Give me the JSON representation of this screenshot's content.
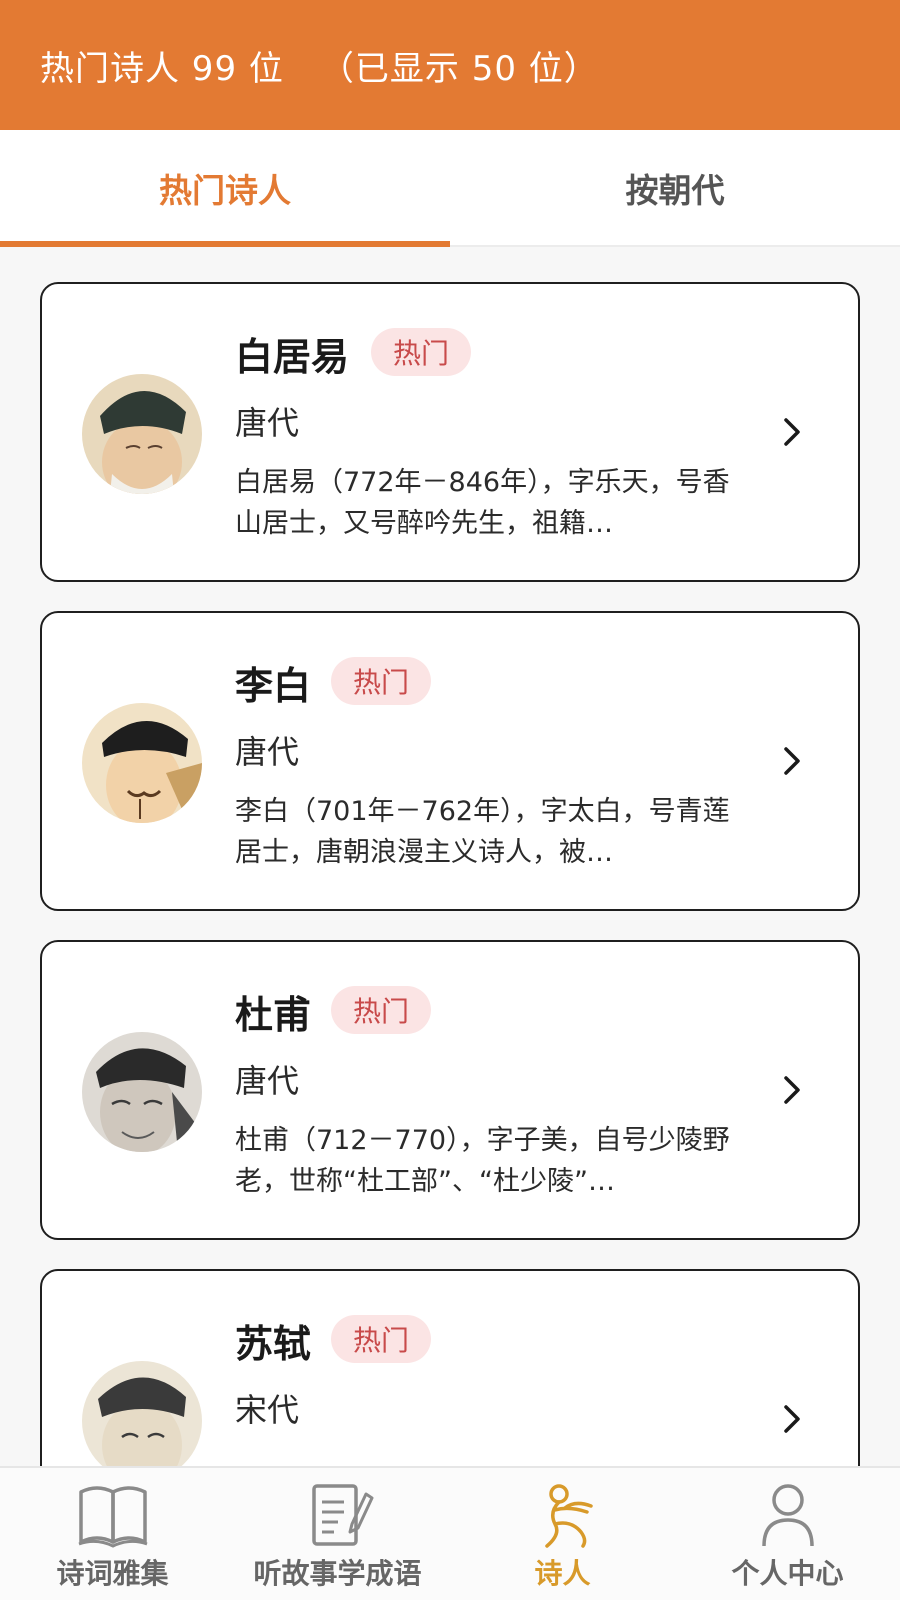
{
  "header": {
    "title": "热门诗人 99 位",
    "shown": "（已显示 50 位）"
  },
  "tabs": [
    {
      "label": "热门诗人",
      "active": true
    },
    {
      "label": "按朝代",
      "active": false
    }
  ],
  "poets": [
    {
      "name": "白居易",
      "badge": "热门",
      "dynasty": "唐代",
      "desc": "白居易（772年－846年），字乐天，号香山居士，又号醉吟先生，祖籍…"
    },
    {
      "name": "李白",
      "badge": "热门",
      "dynasty": "唐代",
      "desc": "李白（701年－762年），字太白，号青莲居士，唐朝浪漫主义诗人，被…"
    },
    {
      "name": "杜甫",
      "badge": "热门",
      "dynasty": "唐代",
      "desc": "杜甫（712－770），字子美，自号少陵野老，世称“杜工部”、“杜少陵”…"
    },
    {
      "name": "苏轼",
      "badge": "热门",
      "dynasty": "宋代",
      "desc": ""
    }
  ],
  "bottom_nav": [
    {
      "label": "诗词雅集",
      "icon": "book-icon",
      "active": false
    },
    {
      "label": "听故事学成语",
      "icon": "notepad-icon",
      "active": false
    },
    {
      "label": "诗人",
      "icon": "poet-icon",
      "active": true
    },
    {
      "label": "个人中心",
      "icon": "person-icon",
      "active": false
    }
  ],
  "colors": {
    "accent": "#e37a33",
    "badge_bg": "#fbe4e4",
    "badge_text": "#c84a4a",
    "active_nav": "#d89a2a"
  }
}
